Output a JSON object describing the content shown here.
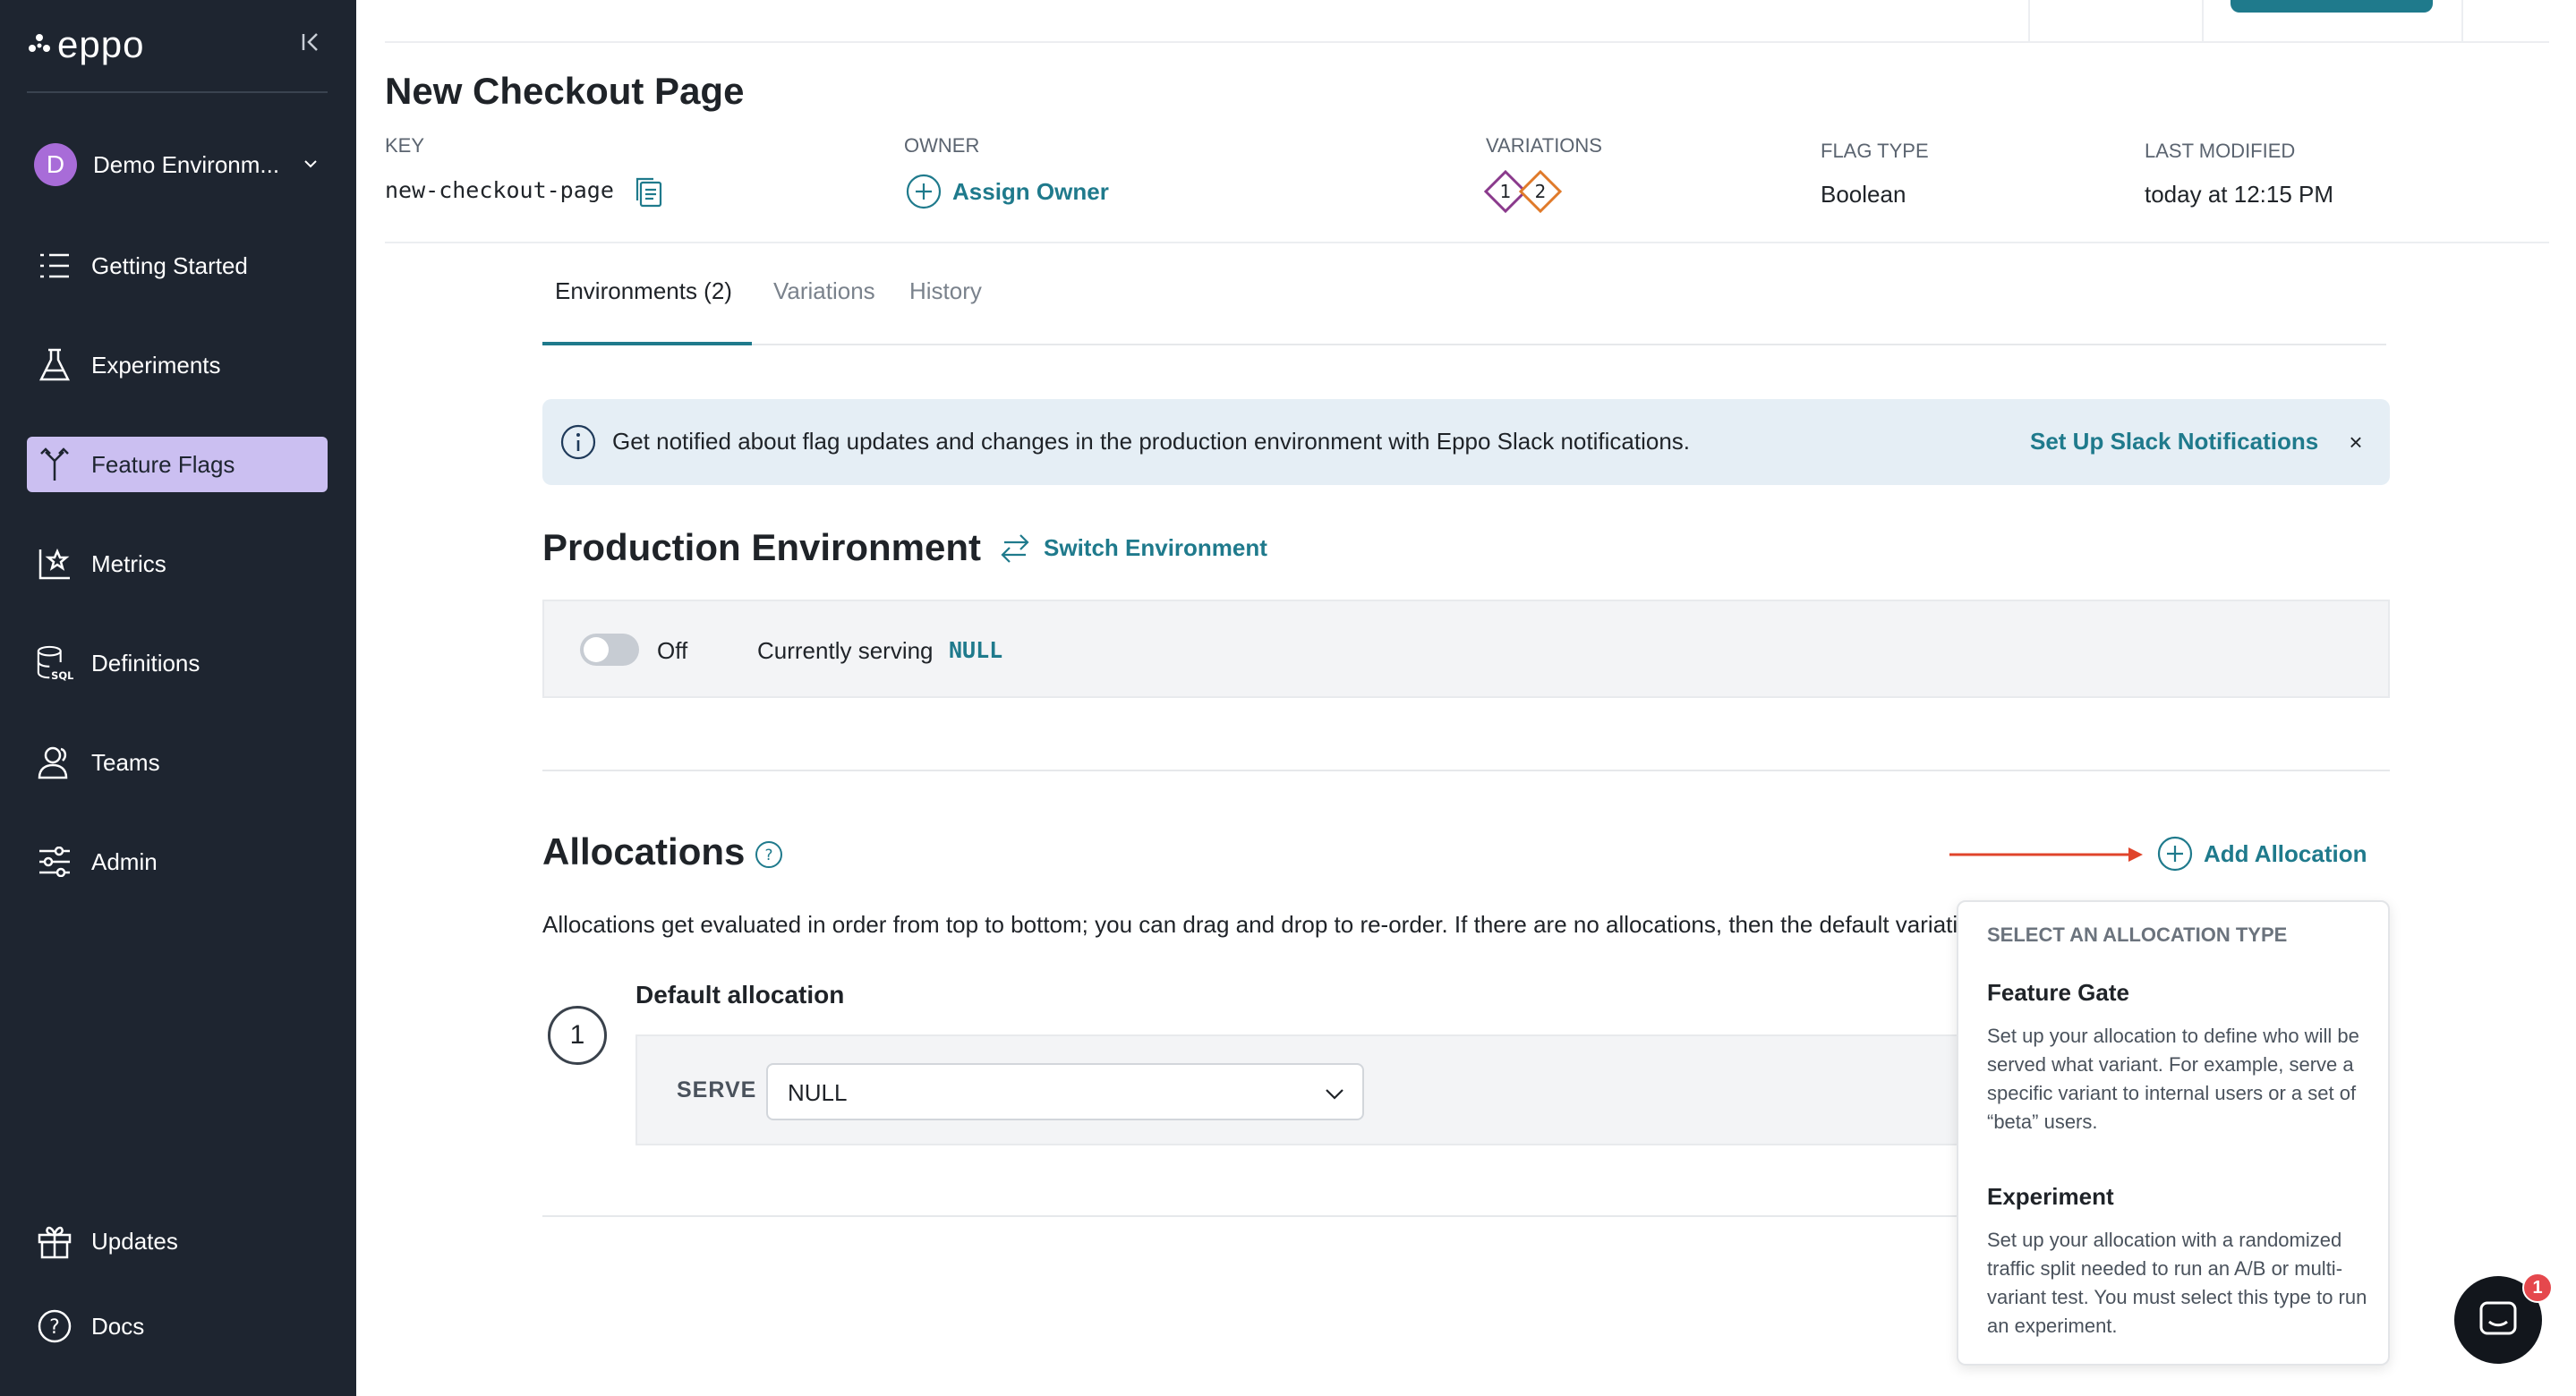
{
  "brand": {
    "name": "eppo"
  },
  "sidebar": {
    "environment": {
      "initial": "D",
      "label": "Demo Environm..."
    },
    "items": [
      {
        "label": "Getting Started",
        "icon": "list-icon"
      },
      {
        "label": "Experiments",
        "icon": "flask-icon"
      },
      {
        "label": "Feature Flags",
        "icon": "flag-split-icon",
        "active": true
      },
      {
        "label": "Metrics",
        "icon": "chart-star-icon"
      },
      {
        "label": "Definitions",
        "icon": "database-sql-icon"
      },
      {
        "label": "Teams",
        "icon": "users-icon"
      },
      {
        "label": "Admin",
        "icon": "sliders-icon"
      }
    ],
    "bottom_items": [
      {
        "label": "Updates",
        "icon": "gift-icon"
      },
      {
        "label": "Docs",
        "icon": "help-circle-icon"
      }
    ]
  },
  "flag": {
    "title": "New Checkout Page",
    "key_label": "KEY",
    "key_value": "new-checkout-page",
    "owner_label": "OWNER",
    "owner_action": "Assign Owner",
    "variations_label": "VARIATIONS",
    "variation_badges": [
      "1",
      "2"
    ],
    "flag_type_label": "FLAG TYPE",
    "flag_type_value": "Boolean",
    "last_modified_label": "LAST MODIFIED",
    "last_modified_value": "today at 12:15 PM"
  },
  "tabs": [
    {
      "label": "Environments (2)",
      "active": true
    },
    {
      "label": "Variations"
    },
    {
      "label": "History"
    }
  ],
  "banner": {
    "text": "Get notified about flag updates and changes in the production environment with Eppo Slack notifications.",
    "action": "Set Up Slack Notifications",
    "close": "×"
  },
  "environment": {
    "title": "Production Environment",
    "switch_label": "Switch Environment",
    "toggle_state": "Off",
    "serving_label": "Currently serving",
    "serving_value": "NULL"
  },
  "allocations": {
    "title": "Allocations",
    "add_label": "Add Allocation",
    "description": "Allocations get evaluated in order from top to bottom; you can drag and drop to re-order. If there are no allocations, then the default variation",
    "default": {
      "step": "1",
      "title": "Default allocation",
      "serve_label": "SERVE",
      "serve_value": "NULL"
    }
  },
  "allocation_menu": {
    "header": "SELECT AN ALLOCATION TYPE",
    "options": [
      {
        "title": "Feature Gate",
        "description": "Set up your allocation to define who will be served what variant. For example, serve a specific variant to internal users or a set of “beta” users."
      },
      {
        "title": "Experiment",
        "description": "Set up your allocation with a randomized traffic split needed to run an A/B or multi-variant test. You must select this type to run an experiment."
      }
    ]
  },
  "chat": {
    "badge_count": "1"
  },
  "colors": {
    "sidebar_bg": "#1e2530",
    "accent": "#1f7a8c",
    "active_nav": "#cbbff1",
    "annotation_arrow": "#e0442b",
    "variation_1": "#8a3a8c",
    "variation_2": "#e07a2a"
  }
}
